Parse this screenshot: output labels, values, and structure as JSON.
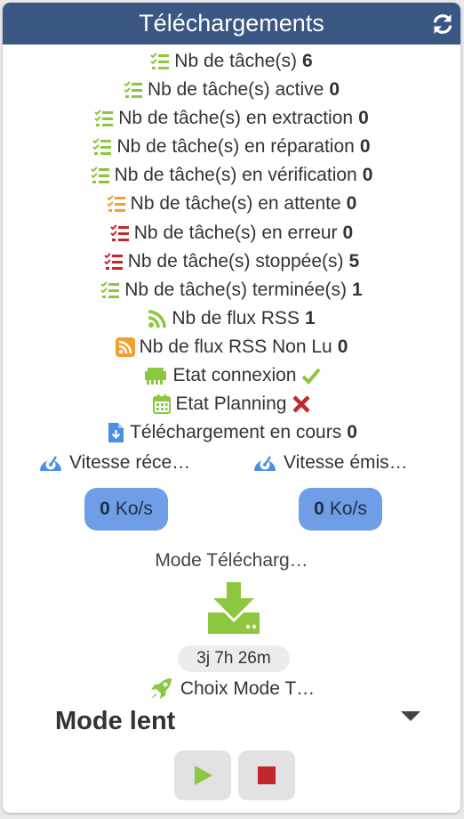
{
  "header": {
    "title": "Téléchargements",
    "refresh_icon": "refresh-icon"
  },
  "stats": [
    {
      "label": "Nb de tâche(s)",
      "value": "6",
      "icon": "tasks-icon",
      "color": "#8dc63f"
    },
    {
      "label": "Nb de tâche(s) active",
      "value": "0",
      "icon": "tasks-icon",
      "color": "#8dc63f"
    },
    {
      "label": "Nb de tâche(s) en extraction",
      "value": "0",
      "icon": "tasks-icon",
      "color": "#8dc63f"
    },
    {
      "label": "Nb de tâche(s) en réparation",
      "value": "0",
      "icon": "tasks-icon",
      "color": "#8dc63f"
    },
    {
      "label": "Nb de tâche(s) en vérification",
      "value": "0",
      "icon": "tasks-icon",
      "color": "#8dc63f"
    },
    {
      "label": "Nb de tâche(s) en attente",
      "value": "0",
      "icon": "tasks-icon",
      "color": "#f0a030"
    },
    {
      "label": "Nb de tâche(s) en erreur",
      "value": "0",
      "icon": "tasks-icon",
      "color": "#c0282d"
    },
    {
      "label": "Nb de tâche(s) stoppée(s)",
      "value": "5",
      "icon": "tasks-icon",
      "color": "#c0282d"
    },
    {
      "label": "Nb de tâche(s) terminée(s)",
      "value": "1",
      "icon": "tasks-icon",
      "color": "#8dc63f"
    },
    {
      "label": "Nb de flux RSS",
      "value": "1",
      "icon": "rss-icon",
      "color": "#8dc63f"
    },
    {
      "label": "Nb de flux RSS Non Lu",
      "value": "0",
      "icon": "rss-square-icon",
      "color": "#f0a030"
    },
    {
      "label": "Etat connexion",
      "icon": "network-icon",
      "color": "#8dc63f",
      "state": "check-icon"
    },
    {
      "label": "Etat Planning",
      "icon": "calendar-icon",
      "color": "#8dc63f",
      "state": "cross-icon"
    },
    {
      "label": "Téléchargement en cours",
      "value": "0",
      "icon": "download-file-icon",
      "color": "#4a90e2"
    }
  ],
  "speed": {
    "download_label": "Vitesse réce…",
    "upload_label": "Vitesse émis…",
    "download_value": "0",
    "upload_value": "0",
    "unit": "Ko/s",
    "icon": "speedometer-icon",
    "pill_color": "#6f9ee6"
  },
  "mode": {
    "label": "Mode Télécharg…",
    "icon": "download-tray-icon",
    "timer": "3j 7h 26m",
    "choice_label": "Choix Mode T…",
    "choice_icon": "rocket-icon",
    "selected": "Mode lent"
  },
  "controls": {
    "play_icon": "play-icon",
    "stop_icon": "stop-icon"
  },
  "colors": {
    "header": "#3a5683",
    "green": "#8dc63f",
    "orange": "#f0a030",
    "red": "#c0282d",
    "blue": "#4a90e2"
  }
}
